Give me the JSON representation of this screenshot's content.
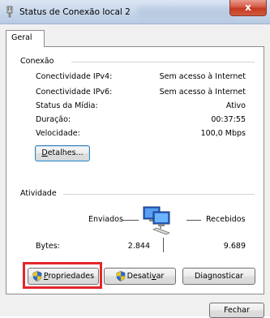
{
  "window": {
    "title": "Status de Conexão local 2",
    "close_symbol": "x"
  },
  "tabs": [
    {
      "label": "Geral"
    }
  ],
  "connection": {
    "group_label": "Conexão",
    "rows": [
      {
        "label": "Conectividade IPv4:",
        "value": "Sem acesso à Internet"
      },
      {
        "label": "Conectividade IPv6:",
        "value": "Sem acesso à Internet"
      },
      {
        "label": "Status da Mídia:",
        "value": "Ativo"
      },
      {
        "label": "Duração:",
        "value": "00:37:55"
      },
      {
        "label": "Velocidade:",
        "value": "100,0 Mbps"
      }
    ],
    "details_button": {
      "mnemonic": "D",
      "rest": "etalhes..."
    }
  },
  "activity": {
    "group_label": "Atividade",
    "sent_label": "Enviados",
    "received_label": "Recebidos",
    "bytes_label": "Bytes:",
    "bytes_sent": "2.844",
    "bytes_received": "9.689"
  },
  "buttons": {
    "properties": {
      "mnemonic": "P",
      "rest": "ropriedades"
    },
    "disable": {
      "before": "Desati",
      "mnemonic": "v",
      "after": "ar"
    },
    "diagnose": {
      "label": "Diagnosticar"
    },
    "close": {
      "label": "Fechar"
    }
  },
  "colors": {
    "highlight": "#e3262b",
    "close_button": "#c43a22",
    "title_bar": "#c6d6ea"
  },
  "icons": [
    "network-adapter-icon",
    "network-computers-icon",
    "uac-shield-icon",
    "close-icon"
  ]
}
